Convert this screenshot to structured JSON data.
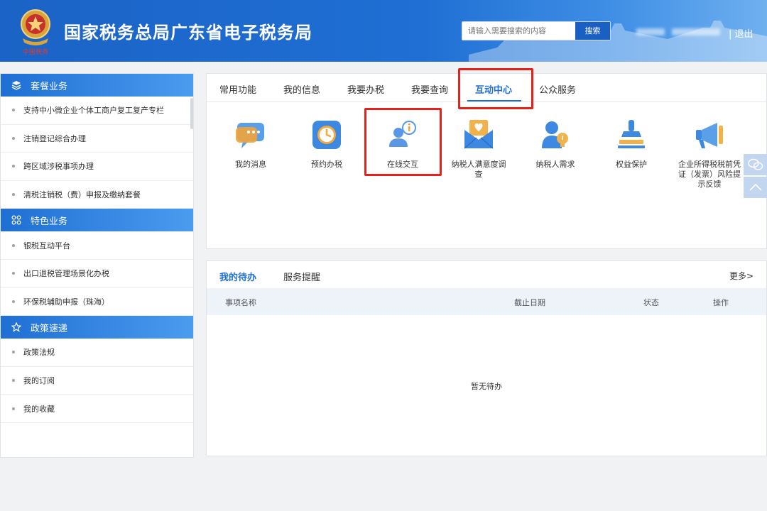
{
  "header": {
    "site_title": "国家税务总局广东省电子税务局",
    "search_placeholder": "请输入需要搜索的内容",
    "search_button": "搜索",
    "logout": "| 退出"
  },
  "sidebar": {
    "sections": [
      {
        "title": "套餐业务",
        "icon": "layers-icon",
        "items": [
          "支持中小微企业个体工商户复工复产专栏",
          "注销登记综合办理",
          "跨区域涉税事项办理",
          "清税注销税（费）申报及缴纳套餐"
        ]
      },
      {
        "title": "特色业务",
        "icon": "grid-icon",
        "items": [
          "银税互动平台",
          "出口退税管理场景化办税",
          "环保税辅助申报（珠海）"
        ]
      },
      {
        "title": "政策速递",
        "icon": "star-icon",
        "items": [
          "政策法规",
          "我的订阅",
          "我的收藏"
        ]
      }
    ]
  },
  "main_tabs": [
    "常用功能",
    "我的信息",
    "我要办税",
    "我要查询",
    "互动中心",
    "公众服务"
  ],
  "active_tab": "互动中心",
  "functions": [
    {
      "label": "我的消息",
      "icon": "message-icon"
    },
    {
      "label": "预约办税",
      "icon": "clock-icon"
    },
    {
      "label": "在线交互",
      "icon": "online-interaction-icon"
    },
    {
      "label": "纳税人满意度调查",
      "icon": "envelope-heart-icon"
    },
    {
      "label": "纳税人需求",
      "icon": "user-idea-icon"
    },
    {
      "label": "权益保护",
      "icon": "stamp-icon"
    },
    {
      "label": "企业所得税税前凭证（发票）风险提示反馈",
      "icon": "megaphone-icon"
    }
  ],
  "todo": {
    "tabs": [
      "我的待办",
      "服务提醒"
    ],
    "more": "更多>",
    "columns": [
      "事项名称",
      "截止日期",
      "状态",
      "操作"
    ],
    "empty_text": "暂无待办"
  },
  "colors": {
    "brand": "#1f6fd4",
    "highlight": "#e8201a"
  }
}
